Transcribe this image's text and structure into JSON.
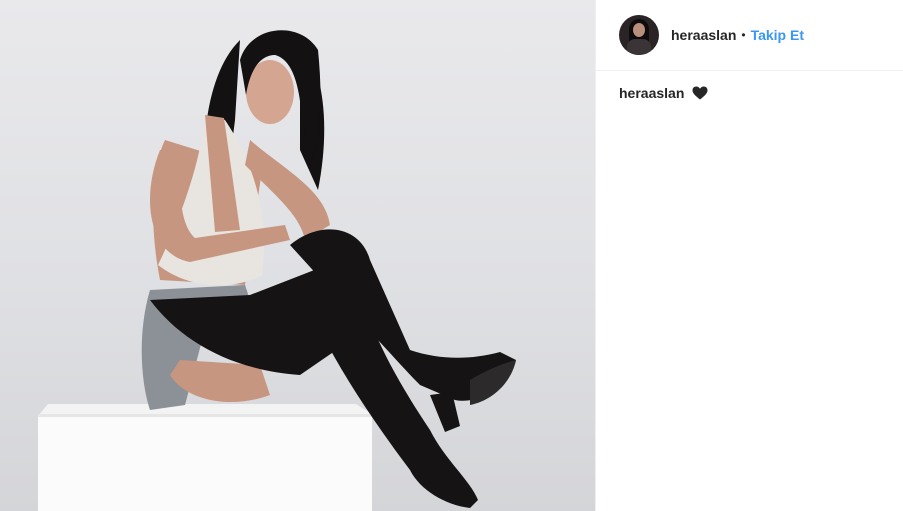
{
  "post": {
    "image_icon": "photo-of-woman-seated-on-white-cube",
    "author": {
      "username": "heraaslan",
      "separator": "•",
      "follow_label": "Takip Et",
      "avatar_icon": "profile-avatar"
    },
    "caption": {
      "username": "heraaslan",
      "emoji_icon": "black-heart-icon"
    }
  },
  "colors": {
    "follow": "#3897f0",
    "text": "#262626",
    "divider": "#efefef"
  }
}
